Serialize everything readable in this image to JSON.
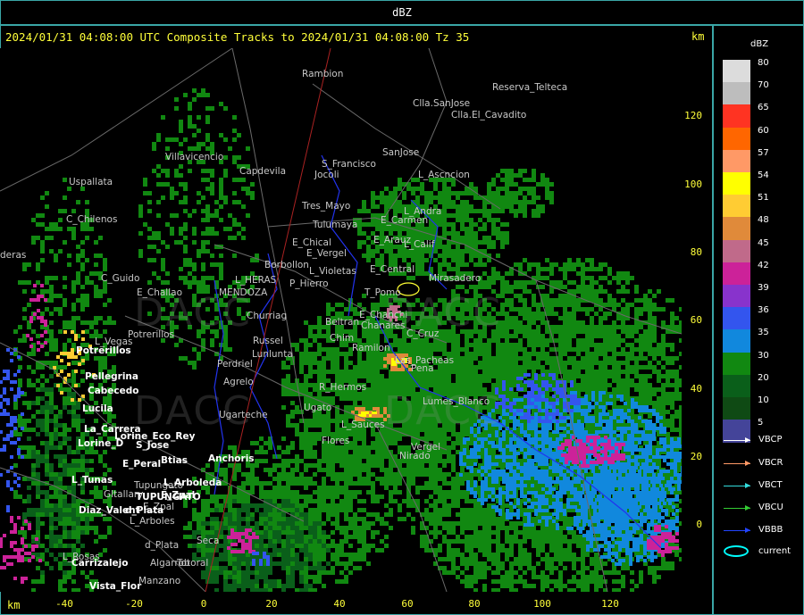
{
  "header": {
    "title": "dBZ"
  },
  "map_title": "2024/01/31 04:08:00 UTC Composite Tracks to 2024/01/31 04:08:00 Tz 35",
  "unit_label": "km",
  "axis_y": {
    "ticks": [
      "120",
      "100",
      "80",
      "60",
      "40",
      "20",
      "0"
    ]
  },
  "axis_x": {
    "ticks": [
      "-40",
      "-20",
      "0",
      "20",
      "40",
      "60",
      "80",
      "100",
      "120"
    ]
  },
  "legend": {
    "title": "dBZ",
    "entries": [
      {
        "value": "80",
        "color": "#dcdcdc"
      },
      {
        "value": "70",
        "color": "#bdbdbd"
      },
      {
        "value": "65",
        "color": "#ff3322"
      },
      {
        "value": "60",
        "color": "#ff6600"
      },
      {
        "value": "57",
        "color": "#ff9966"
      },
      {
        "value": "54",
        "color": "#ffff00"
      },
      {
        "value": "51",
        "color": "#ffcc33"
      },
      {
        "value": "48",
        "color": "#e08a3a"
      },
      {
        "value": "45",
        "color": "#c06a8a"
      },
      {
        "value": "42",
        "color": "#cc2299"
      },
      {
        "value": "39",
        "color": "#8833cc"
      },
      {
        "value": "36",
        "color": "#3355ee"
      },
      {
        "value": "35",
        "color": "#1188dd"
      },
      {
        "value": "30",
        "color": "#118811"
      },
      {
        "value": "20",
        "color": "#0a5f1a"
      },
      {
        "value": "10",
        "color": "#0f4a14"
      },
      {
        "value": "5",
        "color": "#444499"
      }
    ]
  },
  "tracks": [
    {
      "label": "VBCP",
      "color": "#ffffff"
    },
    {
      "label": "VBCR",
      "color": "#ff9966"
    },
    {
      "label": "VBCT",
      "color": "#33dddd"
    },
    {
      "label": "VBCU",
      "color": "#33cc33"
    },
    {
      "label": "VBBB",
      "color": "#2244ff"
    },
    {
      "label": "current",
      "color": "#00ffff"
    }
  ],
  "places_dim": [
    "Rambion",
    "Reserva_Telteca",
    "Clla.SanJose",
    "Clla.El_Cavadito",
    "SanJose",
    "S_Francisco",
    "Jocoli",
    "L_Ascncion",
    "Villavicencio",
    "Capdevila",
    "Uspallata",
    "L_Andra",
    "C_Chilenos",
    "Tres_Mayo",
    "E_Carmen",
    "Tulumaya",
    "E_Arauz",
    "L_Calif",
    "E_Chical",
    "E_Vergel",
    "deras",
    "Borbollon",
    "L_Violetas",
    "E_Central",
    "Mirasadero",
    "C_Guido",
    "P_Hierro",
    "L_HERAS",
    "E_Challao",
    "MENDOZA",
    "T_Pomo",
    "E_Chanchi",
    "Beltran",
    "Chanares",
    "C_Cruz",
    "Churriag",
    "Chim",
    "Las_Pacheas",
    "L_Vegas",
    "Potrerillos",
    "Russel",
    "Perdriel",
    "Lunlunta",
    "Agrelo",
    "Ugarteche",
    "Lumes_Blanco",
    "Ramilon",
    "Pena",
    "R_Hermos",
    "Ugato",
    "Nirado",
    "Tupungato",
    "Gltallary",
    "E_Zpal",
    "L_Arboles",
    "d_Plata",
    "Algarrob",
    "Seca",
    "Totoral",
    "L_Rosas",
    "Manzano",
    "Flores",
    "L_Sauces",
    "Vergel",
    "Pardo"
  ],
  "places_bright": [
    "Potrerillos",
    "Pellegrina",
    "Cabecedo",
    "Lucila",
    "La_Carrera",
    "Lorine_D",
    "Lorine_Eco_Rey",
    "S_Jose",
    "E_Peral",
    "Btias",
    "Anchoris",
    "L_Tunas",
    "TUPUNGATO",
    "E_Zpal",
    "L_Arboleda",
    "Diaz_Valent",
    "d_Plata",
    "Carrizalejo",
    "Vista_Flor"
  ],
  "watermark_text": "DACC"
}
